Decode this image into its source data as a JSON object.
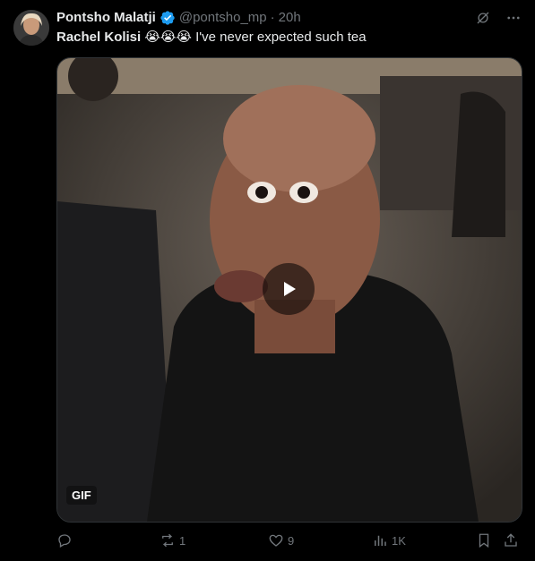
{
  "author": {
    "name": "Pontsho Malatji",
    "handle": "@pontsho_mp",
    "separator": "·",
    "time": "20h",
    "avatar_icon": "avatar-photo"
  },
  "tweet": {
    "mention": "Rachel Kolisi",
    "emojis": "😭😭😭",
    "text": " I've never expected such tea"
  },
  "media": {
    "badge": "GIF",
    "play_icon": "play-icon"
  },
  "actions": {
    "replies": "",
    "reposts": "1",
    "likes": "9",
    "views": "1K"
  },
  "colors": {
    "background": "#000000",
    "text": "#e7e9ea",
    "muted": "#71767b",
    "verified": "#1d9bf0"
  }
}
